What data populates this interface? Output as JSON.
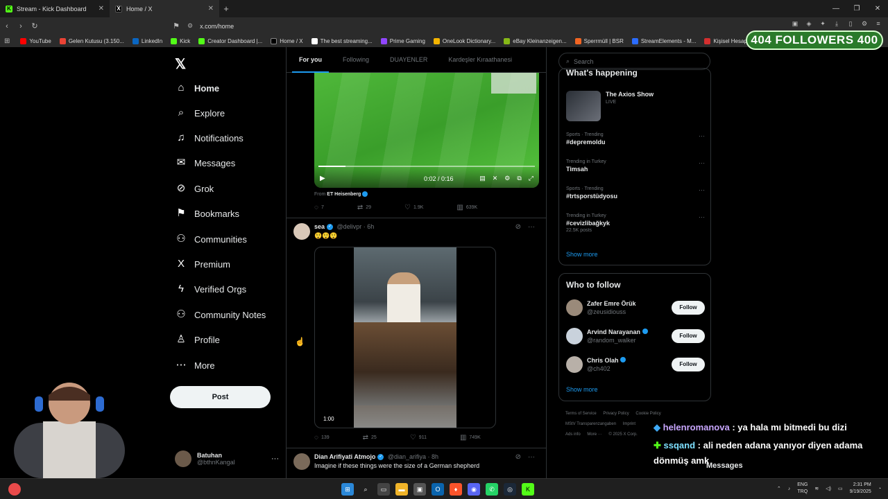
{
  "browser": {
    "tabs": [
      {
        "title": "Stream - Kick Dashboard",
        "favicon": "K",
        "color": "#53fc18"
      },
      {
        "title": "Home / X",
        "favicon": "X",
        "color": "#000000"
      }
    ],
    "url": "x.com/home"
  },
  "bookmarks": [
    {
      "label": "YouTube",
      "color": "#ff0000"
    },
    {
      "label": "Gelen Kutusu (3.150...",
      "color": "#ea4335"
    },
    {
      "label": "LinkedIn",
      "color": "#0a66c2"
    },
    {
      "label": "Kick",
      "color": "#53fc18"
    },
    {
      "label": "Creator Dashboard |...",
      "color": "#53fc18"
    },
    {
      "label": "Home / X",
      "color": "#000000"
    },
    {
      "label": "The best streaming...",
      "color": "#ffffff"
    },
    {
      "label": "Prime Gaming",
      "color": "#9146ff"
    },
    {
      "label": "OneLook Dictionary...",
      "color": "#f4b400"
    },
    {
      "label": "eBay Kleinanzeigen...",
      "color": "#86b817"
    },
    {
      "label": "Sperrmüll | BSR",
      "color": "#f26522"
    },
    {
      "label": "StreamElements - M...",
      "color": "#2b6cff"
    },
    {
      "label": "Kişisel Hesap Yöneti...",
      "color": "#d32f2f"
    }
  ],
  "overlay": {
    "followers": "404 FOLLOWERS 400",
    "chat": [
      {
        "user": "helenromanova",
        "msg": ": ya hala mı bitmedi bu dizi"
      },
      {
        "user": "ssqand",
        "msg": ": ali neden adana yanıyor diyen adama dönmüş amk"
      }
    ]
  },
  "sidebar": {
    "items": [
      {
        "label": "Home",
        "icon": "home-icon",
        "glyph": "⌂"
      },
      {
        "label": "Explore",
        "icon": "search-icon",
        "glyph": "⌕"
      },
      {
        "label": "Notifications",
        "icon": "bell-icon",
        "glyph": "♫"
      },
      {
        "label": "Messages",
        "icon": "mail-icon",
        "glyph": "✉"
      },
      {
        "label": "Grok",
        "icon": "grok-icon",
        "glyph": "⊘"
      },
      {
        "label": "Bookmarks",
        "icon": "bookmark-icon",
        "glyph": "⚑"
      },
      {
        "label": "Communities",
        "icon": "communities-icon",
        "glyph": "⚇"
      },
      {
        "label": "Premium",
        "icon": "premium-icon",
        "glyph": "X"
      },
      {
        "label": "Verified Orgs",
        "icon": "lightning-icon",
        "glyph": "ϟ"
      },
      {
        "label": "Community Notes",
        "icon": "notes-icon",
        "glyph": "⚇"
      },
      {
        "label": "Profile",
        "icon": "person-icon",
        "glyph": "♙"
      },
      {
        "label": "More",
        "icon": "more-icon",
        "glyph": "⋯"
      }
    ],
    "post_label": "Post",
    "account": {
      "name": "Batuhan",
      "handle": "@bthnKangal"
    }
  },
  "feed": {
    "tabs": [
      "For you",
      "Following",
      "DUAYENLER",
      "Kardeşler Kıraathanesi"
    ],
    "video1": {
      "time": "0:02 / 0:16",
      "progress": 0.125,
      "from_label": "From",
      "from_name": "ET Heisenberg"
    },
    "post1_actions": {
      "replies": "7",
      "reposts": "29",
      "likes": "1.9K",
      "views": "639K"
    },
    "post2": {
      "name": "sea",
      "handle": "@delivpr",
      "time": "· 6h",
      "text": "😲😲😲",
      "duration": "1:00",
      "actions": {
        "replies": "139",
        "reposts": "25",
        "likes": "911",
        "views": "749K"
      }
    },
    "post3": {
      "name": "Dian Arifiyati Atmojo",
      "handle": "@dian_arifiya",
      "time": "· 8h",
      "text": "Imagine if these things were the size of a German shepherd"
    }
  },
  "right": {
    "search_placeholder": "Search",
    "happening_title": "What's happening",
    "axios": {
      "title": "The Axios Show",
      "status": "LIVE"
    },
    "trends": [
      {
        "cat": "Sports · Trending",
        "title": "#depremoldu",
        "count": ""
      },
      {
        "cat": "Trending in Turkey",
        "title": "Timsah",
        "count": ""
      },
      {
        "cat": "Sports · Trending",
        "title": "#trtsporstüdyosu",
        "count": ""
      },
      {
        "cat": "Trending in Turkey",
        "title": "#cevizlibağkyk",
        "count": "22.5K posts"
      }
    ],
    "show_more": "Show more",
    "who_title": "Who to follow",
    "who": [
      {
        "name": "Zafer Emre Örük",
        "handle": "@zeusidiouss",
        "verified": false
      },
      {
        "name": "Arvind Narayanan",
        "handle": "@random_walker",
        "verified": true
      },
      {
        "name": "Chris Olah",
        "handle": "@ch402",
        "verified": true
      }
    ],
    "follow_label": "Follow",
    "footer": [
      "Terms of Service",
      "Privacy Policy",
      "Cookie Policy",
      "MStV Transparenzangaben",
      "Imprint",
      "Ads info",
      "More ···",
      "© 2025 X Corp."
    ]
  },
  "messages_label": "Messages",
  "taskbar": {
    "lang_top": "ENG",
    "lang_bottom": "TRQ",
    "time": "2:31 PM",
    "date": "9/19/2025"
  }
}
